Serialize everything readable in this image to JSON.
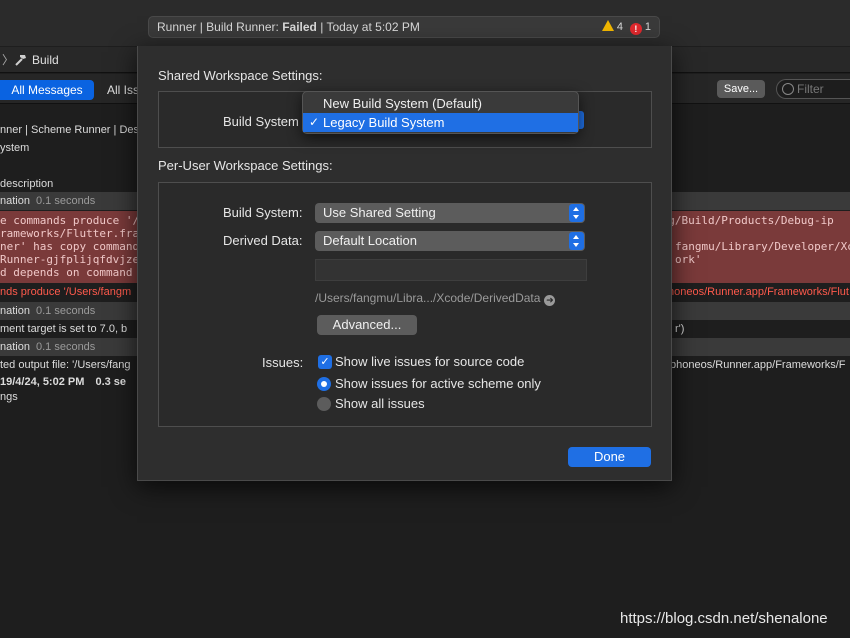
{
  "titlebar": {
    "activity_prefix": "Runner | Build Runner: ",
    "activity_status": "Failed",
    "activity_suffix": " | Today at 5:02 PM",
    "warning_count": "4",
    "error_count": "1"
  },
  "jumpbar": {
    "chevron": "〉",
    "label": "Build"
  },
  "filterbar": {
    "all_messages": "All Messages",
    "all_issues": "All Iss",
    "save": "Save...",
    "filter_placeholder": "Filter"
  },
  "log": {
    "lines": [
      "nner | Scheme Runner | Des",
      "ystem",
      "",
      "description"
    ],
    "grey_rows": [
      {
        "text": "nation",
        "time": "0.1 seconds"
      },
      {
        "text": "nation",
        "time": "0.1 seconds"
      },
      {
        "text": "nation",
        "time": "0.1 seconds"
      }
    ],
    "error_left": [
      "e commands produce '/",
      "rameworks/Flutter.fra",
      "ner' has copy command",
      "Runner-gjfplijqfdvjze",
      "d depends on command"
    ],
    "error_right": [
      "ohg/Build/Products/Debug-ip",
      "",
      "fangmu/Library/Developer/Xc",
      "ork'",
      ""
    ],
    "red_left": "nds produce '/Users/fangm",
    "red_right": "honeos/Runner.app/Frameworks/Flut",
    "deploy_left": "ment target is set to 7.0, b",
    "deploy_right": "r')",
    "output_left": "ted output file: '/Users/fang",
    "output_right": "phoneos/Runner.app/Frameworks/F",
    "summary_date": "19/4/24, 5:02 PM",
    "summary_time": "0.3 se",
    "summary_tail": "ngs"
  },
  "sheet": {
    "shared_title": "Shared Workspace Settings:",
    "shared_build_label": "Build System",
    "build_menu": {
      "items": [
        "New Build System (Default)",
        "Legacy Build System"
      ],
      "selected_index": 1,
      "check": "✓"
    },
    "peruser_title": "Per-User Workspace Settings:",
    "peruser_build_label": "Build System:",
    "peruser_build_value": "Use Shared Setting",
    "derived_label": "Derived Data:",
    "derived_value": "Default Location",
    "derived_path": "/Users/fangmu/Libra.../Xcode/DerivedData",
    "advanced": "Advanced...",
    "issues_label": "Issues:",
    "issue_live": "Show live issues for source code",
    "issue_active": "Show issues for active scheme only",
    "issue_all": "Show all issues",
    "done": "Done"
  },
  "watermark": "https://blog.csdn.net/shenalone",
  "colors": {
    "accent": "#1f6fe4",
    "error_bg": "#7a3a3a",
    "error_text": "#ff5a4c"
  }
}
